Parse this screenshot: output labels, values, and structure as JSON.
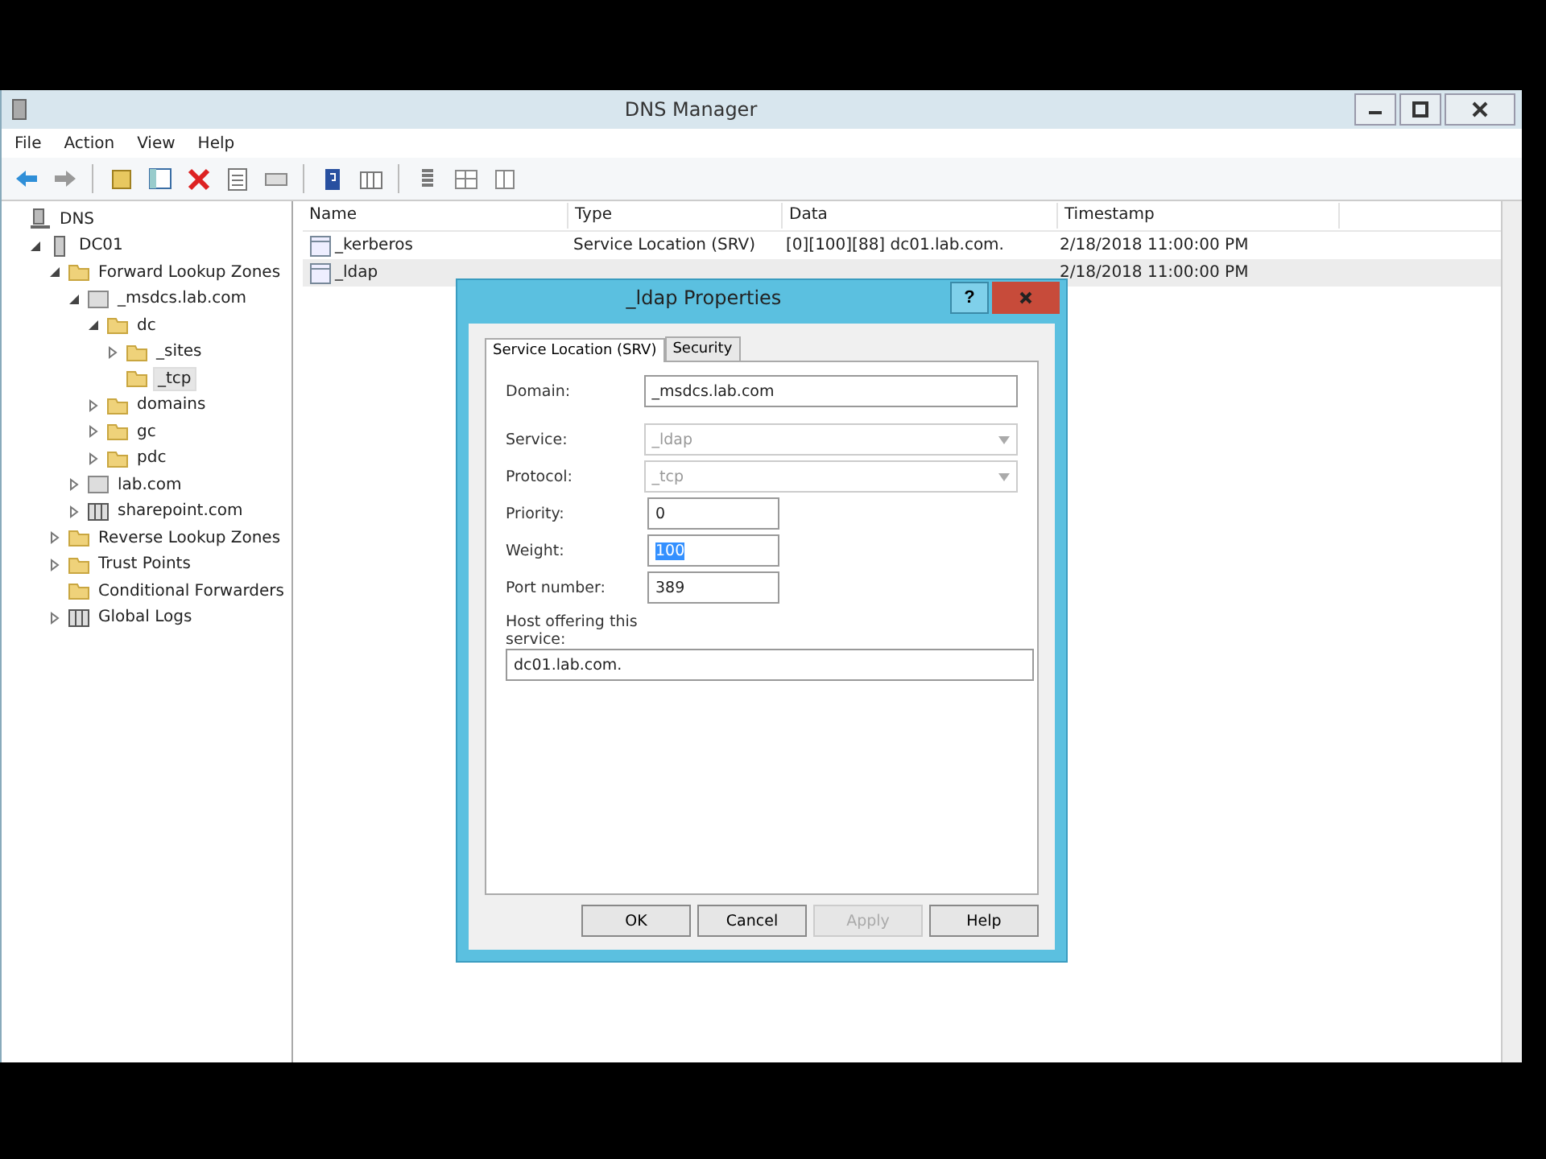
{
  "window": {
    "title": "DNS Manager"
  },
  "menu": [
    "File",
    "Action",
    "View",
    "Help"
  ],
  "tree": [
    {
      "label": "DNS",
      "kind": "root",
      "selected": false,
      "children": [
        {
          "label": "DC01",
          "kind": "server",
          "expanded": true,
          "selected": false,
          "children": [
            {
              "label": "Forward Lookup Zones",
              "kind": "folder",
              "expanded": true,
              "selected": false,
              "children": [
                {
                  "label": "_msdcs.lab.com",
                  "kind": "zone",
                  "expanded": true,
                  "selected": false,
                  "children": [
                    {
                      "label": "dc",
                      "kind": "folder",
                      "expanded": true,
                      "selected": false,
                      "children": [
                        {
                          "label": "_sites",
                          "kind": "folder",
                          "expanded": false,
                          "selected": false
                        },
                        {
                          "label": "_tcp",
                          "kind": "folder",
                          "selected": true
                        }
                      ]
                    },
                    {
                      "label": "domains",
                      "kind": "folder",
                      "expanded": false,
                      "selected": false
                    },
                    {
                      "label": "gc",
                      "kind": "folder",
                      "expanded": false,
                      "selected": false
                    },
                    {
                      "label": "pdc",
                      "kind": "folder",
                      "expanded": false,
                      "selected": false
                    }
                  ]
                },
                {
                  "label": "lab.com",
                  "kind": "zone",
                  "expanded": false,
                  "selected": false
                },
                {
                  "label": "sharepoint.com",
                  "kind": "book",
                  "expanded": false,
                  "selected": false
                }
              ]
            },
            {
              "label": "Reverse Lookup Zones",
              "kind": "folder",
              "expanded": false,
              "selected": false
            },
            {
              "label": "Trust Points",
              "kind": "folder",
              "expanded": false,
              "selected": false
            },
            {
              "label": "Conditional Forwarders",
              "kind": "folder",
              "selected": false
            },
            {
              "label": "Global Logs",
              "kind": "book",
              "expanded": false,
              "selected": false
            }
          ]
        }
      ]
    }
  ],
  "list": {
    "columns": [
      "Name",
      "Type",
      "Data",
      "Timestamp"
    ],
    "rows": [
      {
        "selected": false,
        "cells": [
          "_kerberos",
          "Service Location (SRV)",
          "[0][100][88] dc01.lab.com.",
          "2/18/2018 11:00:00 PM"
        ]
      },
      {
        "selected": true,
        "cells": [
          "_ldap",
          "",
          "",
          "2/18/2018 11:00:00 PM"
        ]
      }
    ]
  },
  "dialog": {
    "title": "_ldap Properties",
    "help": "?",
    "tabs": [
      {
        "label": "Service Location (SRV)",
        "selected": true
      },
      {
        "label": "Security",
        "selected": false
      }
    ],
    "fields": [
      {
        "kind": "text",
        "label": "Domain:",
        "value": "_msdcs.lab.com",
        "disabled": false
      },
      {
        "kind": "combo",
        "label": "Service:",
        "value": "_ldap",
        "disabled": true
      },
      {
        "kind": "combo",
        "label": "Protocol:",
        "value": "_tcp",
        "disabled": true
      },
      {
        "kind": "short",
        "label": "Priority:",
        "value": "0",
        "highlighted": false
      },
      {
        "kind": "short",
        "label": "Weight:",
        "value": "100",
        "highlighted": true
      },
      {
        "kind": "short",
        "label": "Port number:",
        "value": "389",
        "highlighted": false
      },
      {
        "kind": "wide",
        "label": "Host offering this service:",
        "value": "dc01.lab.com."
      }
    ],
    "buttons": [
      {
        "label": "OK",
        "disabled": false
      },
      {
        "label": "Cancel",
        "disabled": false
      },
      {
        "label": "Apply",
        "disabled": true
      },
      {
        "label": "Help",
        "disabled": false
      }
    ]
  }
}
